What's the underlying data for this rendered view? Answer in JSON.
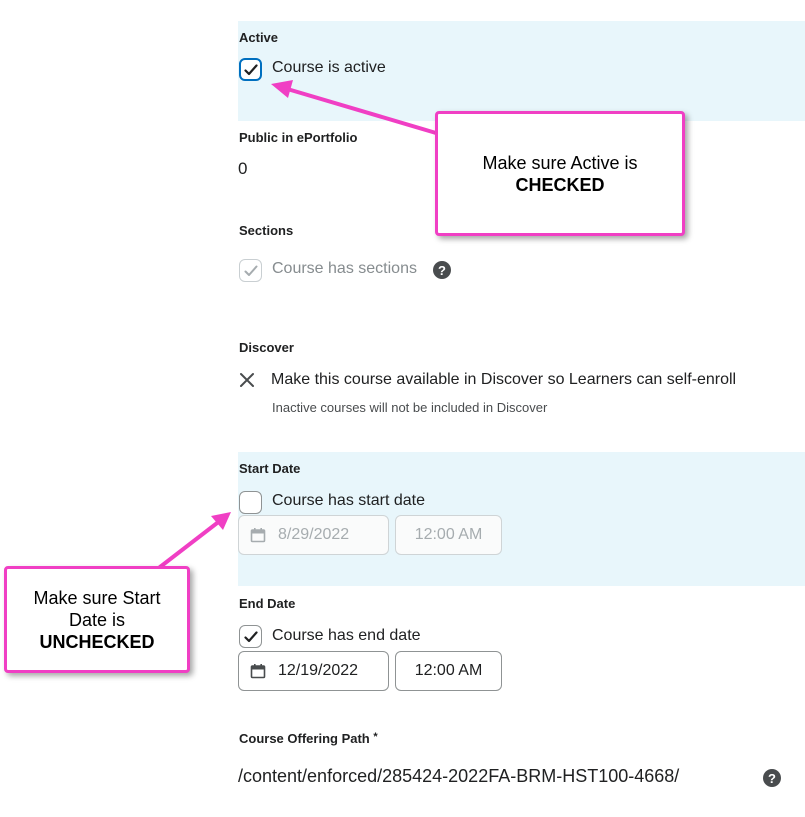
{
  "active": {
    "label": "Active",
    "checkbox_label": "Course is active",
    "checked": true
  },
  "public_eportfolio": {
    "label": "Public in ePortfolio",
    "value": "0"
  },
  "sections": {
    "label": "Sections",
    "checkbox_label": "Course has sections",
    "checked": true,
    "disabled": true
  },
  "discover": {
    "label": "Discover",
    "text": "Make this course available in Discover so Learners can self-enroll",
    "note": "Inactive courses will not be included in Discover"
  },
  "start_date": {
    "label": "Start Date",
    "checkbox_label": "Course has start date",
    "checked": false,
    "date": "8/29/2022",
    "time": "12:00 AM"
  },
  "end_date": {
    "label": "End Date",
    "checkbox_label": "Course has end date",
    "checked": true,
    "date": "12/19/2022",
    "time": "12:00 AM"
  },
  "course_offering_path": {
    "label": "Course Offering Path",
    "required_marker": "*",
    "value": "/content/enforced/285424-2022FA-BRM-HST100-4668/"
  },
  "callouts": {
    "active": {
      "line1": "Make sure Active is",
      "line2": "CHECKED"
    },
    "start": {
      "line1": "Make sure Start",
      "line2": "Date is",
      "line3": "UNCHECKED"
    }
  },
  "colors": {
    "highlight": "#e8f6fb",
    "callout_border": "#f03fc4",
    "focus": "#006fbf"
  }
}
